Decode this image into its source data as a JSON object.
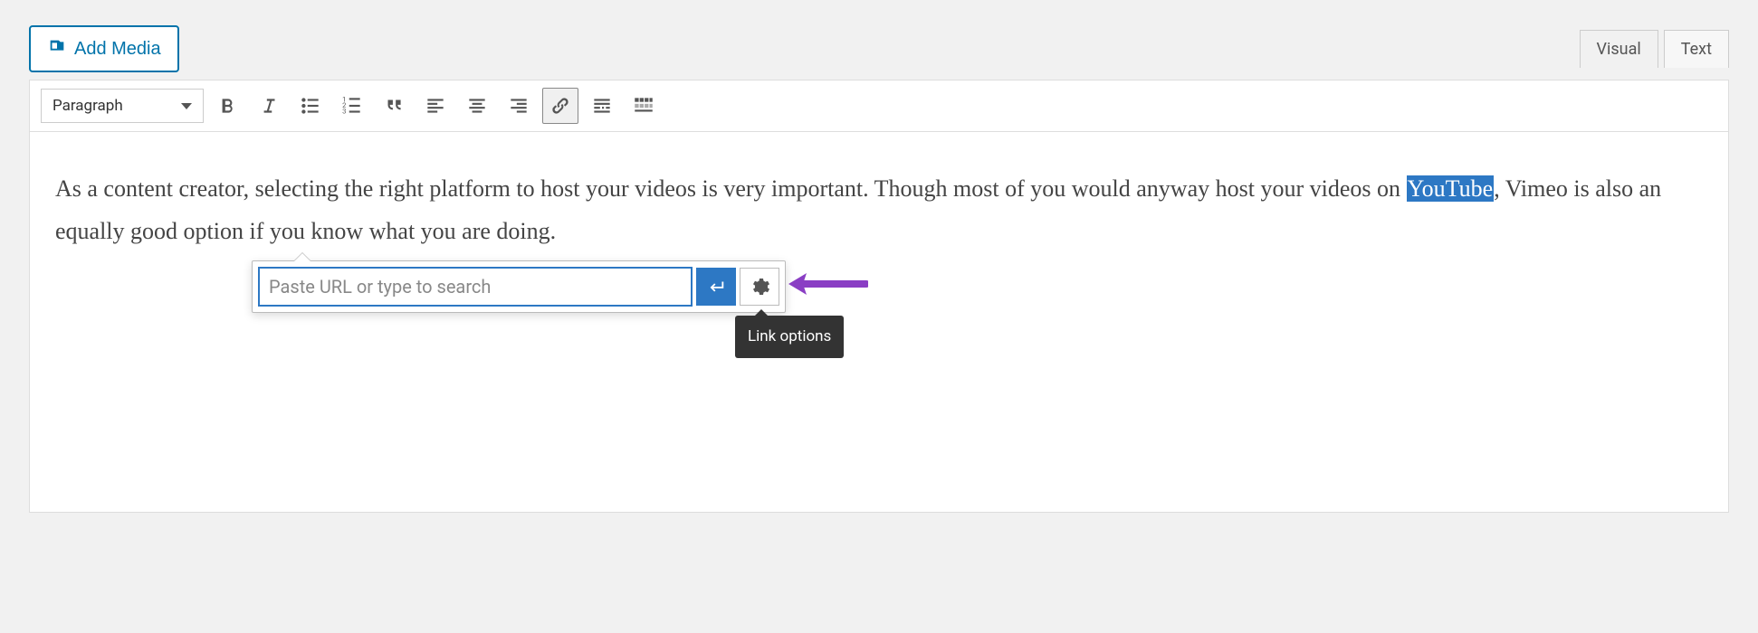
{
  "topbar": {
    "add_media": "Add Media",
    "tabs": {
      "visual": "Visual",
      "text": "Text"
    }
  },
  "toolbar": {
    "format": "Paragraph"
  },
  "content": {
    "before": "As a content creator, selecting the right platform to host your videos is very important. Though most of you would anyway host your videos on ",
    "selected": "YouTube",
    "after": ", Vimeo is also an equally good option if you know what you are doing."
  },
  "link_popover": {
    "placeholder": "Paste URL or type to search",
    "tooltip": "Link options"
  }
}
